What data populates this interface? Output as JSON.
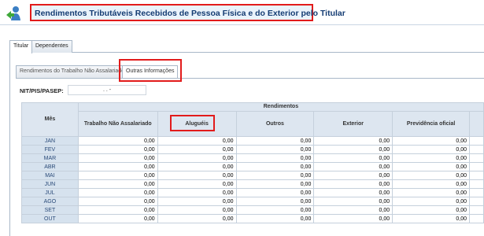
{
  "header": {
    "title": "Rendimentos Tributáveis Recebidos de Pessoa Física e do Exterior pelo Titular",
    "back_icon": "back-arrow-person-icon"
  },
  "tabs_top": [
    {
      "label": "Titular",
      "active": true
    },
    {
      "label": "Dependentes",
      "active": false
    }
  ],
  "tabs_inner": [
    {
      "label": "Rendimentos do Trabalho Não Assalariado",
      "active": false
    },
    {
      "label": "Outras Informações",
      "active": true
    }
  ],
  "nit": {
    "label": "NIT/PIS/PASEP:",
    "value": ". . -"
  },
  "grid": {
    "group_header": "Rendimentos",
    "col_mes": "Mês",
    "columns": [
      "Trabalho Não Assalariado",
      "Aluguéis",
      "Outros",
      "Exterior",
      "Previdência oficial"
    ],
    "rows": [
      {
        "mes": "JAN",
        "values": [
          "0,00",
          "0,00",
          "0,00",
          "0,00",
          "0,00"
        ]
      },
      {
        "mes": "FEV",
        "values": [
          "0,00",
          "0,00",
          "0,00",
          "0,00",
          "0,00"
        ]
      },
      {
        "mes": "MAR",
        "values": [
          "0,00",
          "0,00",
          "0,00",
          "0,00",
          "0,00"
        ]
      },
      {
        "mes": "ABR",
        "values": [
          "0,00",
          "0,00",
          "0,00",
          "0,00",
          "0,00"
        ]
      },
      {
        "mes": "MAI",
        "values": [
          "0,00",
          "0,00",
          "0,00",
          "0,00",
          "0,00"
        ]
      },
      {
        "mes": "JUN",
        "values": [
          "0,00",
          "0,00",
          "0,00",
          "0,00",
          "0,00"
        ]
      },
      {
        "mes": "JUL",
        "values": [
          "0,00",
          "0,00",
          "0,00",
          "0,00",
          "0,00"
        ]
      },
      {
        "mes": "AGO",
        "values": [
          "0,00",
          "0,00",
          "0,00",
          "0,00",
          "0,00"
        ]
      },
      {
        "mes": "SET",
        "values": [
          "0,00",
          "0,00",
          "0,00",
          "0,00",
          "0,00"
        ]
      },
      {
        "mes": "OUT",
        "values": [
          "0,00",
          "0,00",
          "0,00",
          "0,00",
          "0,00"
        ]
      }
    ]
  },
  "colors": {
    "highlight": "#e21b1b",
    "header_bg": "#dde6f0",
    "title_color": "#143c73"
  }
}
